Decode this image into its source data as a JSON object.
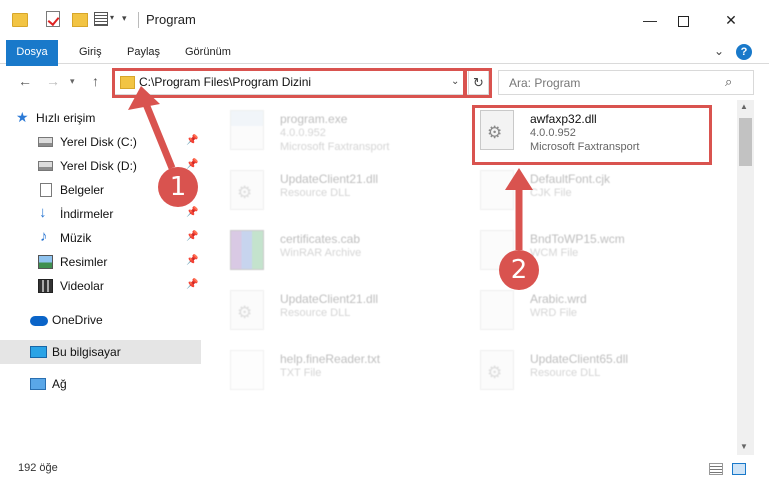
{
  "window": {
    "title": "Program"
  },
  "ribbon": {
    "tabs": [
      "Dosya",
      "Giriş",
      "Paylaş",
      "Görünüm"
    ]
  },
  "navigation": {
    "address": "C:\\Program Files\\Program Dizini",
    "search_placeholder": "Ara: Program"
  },
  "sidebar": {
    "items": [
      {
        "label": "Hızlı erişim",
        "icon": "star-icon"
      },
      {
        "label": "Yerel Disk (C:)",
        "icon": "drive-icon",
        "pinned": true
      },
      {
        "label": "Yerel Disk (D:)",
        "icon": "drive-icon",
        "pinned": true
      },
      {
        "label": "Belgeler",
        "icon": "document-icon",
        "pinned": true
      },
      {
        "label": "İndirmeler",
        "icon": "download-icon",
        "pinned": true
      },
      {
        "label": "Müzik",
        "icon": "music-icon",
        "pinned": true
      },
      {
        "label": "Resimler",
        "icon": "pictures-icon",
        "pinned": true
      },
      {
        "label": "Videolar",
        "icon": "video-icon",
        "pinned": true
      },
      {
        "label": "OneDrive",
        "icon": "cloud-icon"
      },
      {
        "label": "Bu bilgisayar",
        "icon": "computer-icon",
        "selected": true
      },
      {
        "label": "Ağ",
        "icon": "network-icon"
      }
    ]
  },
  "files": [
    {
      "name": "program.exe",
      "line1": "4.0.0.952",
      "line2": "Microsoft Faxtransport",
      "icon": "exe-icon"
    },
    {
      "name": "awfaxp32.dll",
      "line1": "4.0.0.952",
      "line2": "Microsoft Faxtransport",
      "icon": "dll-gear-icon",
      "highlighted": true
    },
    {
      "name": "UpdateClient21.dll",
      "line1": "Resource DLL",
      "line2": "",
      "icon": "dll-gear-icon"
    },
    {
      "name": "DefaultFont.cjk",
      "line1": "CJK File",
      "line2": "",
      "icon": "file-icon"
    },
    {
      "name": "certificates.cab",
      "line1": "WinRAR Archive",
      "line2": "",
      "icon": "archive-icon"
    },
    {
      "name": "BndToWP15.wcm",
      "line1": "WCM File",
      "line2": "",
      "icon": "file-icon"
    },
    {
      "name": "UpdateClient21.dll",
      "line1": "Resource DLL",
      "line2": "",
      "icon": "dll-gear-icon"
    },
    {
      "name": "Arabic.wrd",
      "line1": "WRD File",
      "line2": "",
      "icon": "file-icon"
    },
    {
      "name": "help.fineReader.txt",
      "line1": "TXT File",
      "line2": "",
      "icon": "text-file-icon"
    },
    {
      "name": "UpdateClient65.dll",
      "line1": "Resource DLL",
      "line2": "",
      "icon": "dll-gear-icon"
    }
  ],
  "status": {
    "count": "192 öğe"
  },
  "annotations": {
    "step1": "1",
    "step2": "2",
    "color": "#d9534f"
  }
}
